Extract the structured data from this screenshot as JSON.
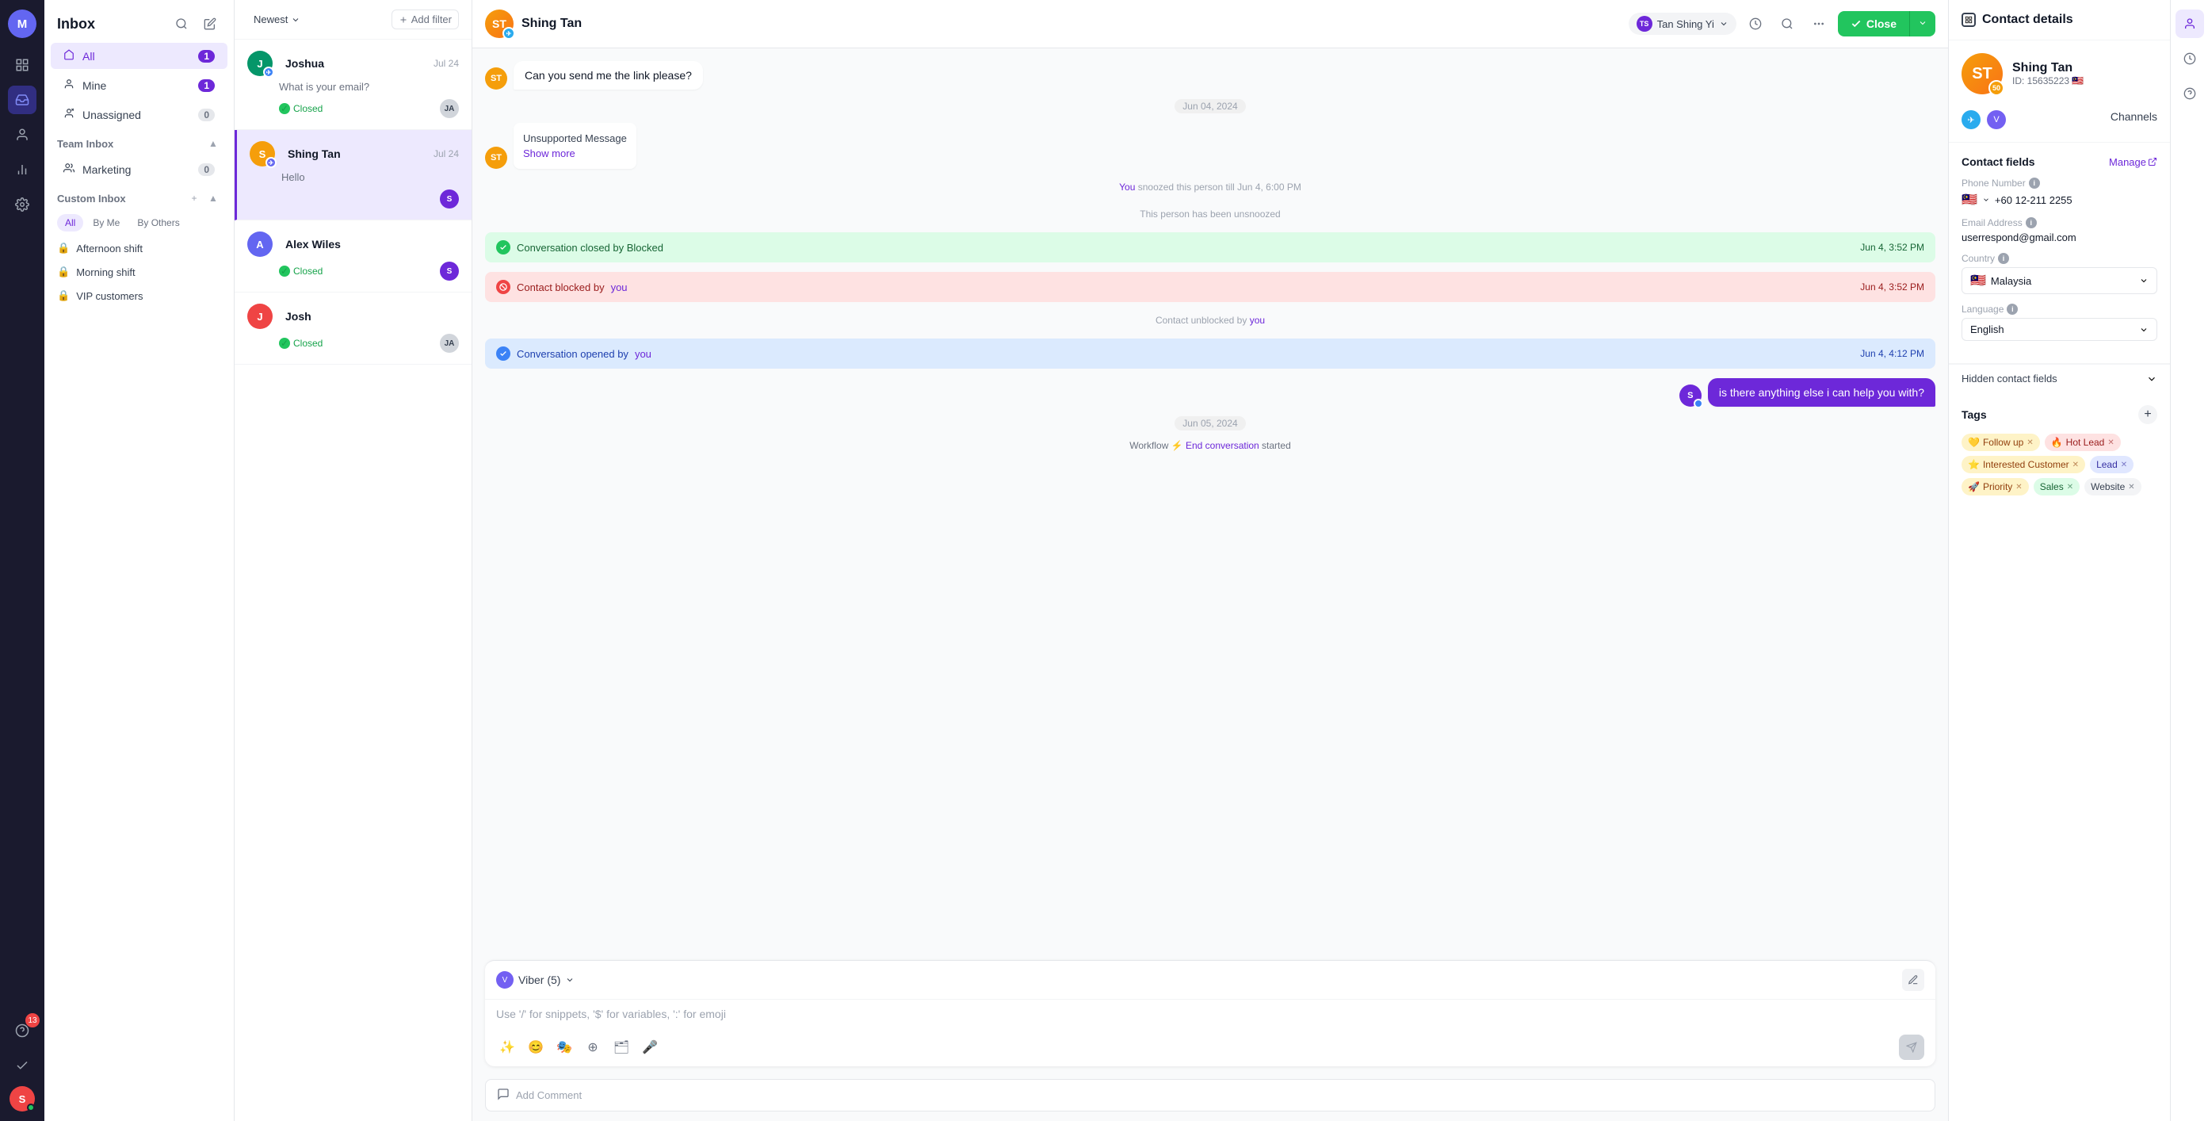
{
  "app": {
    "title": "Inbox"
  },
  "nav": {
    "user_initial": "S",
    "badge_count": "13",
    "icons": [
      "grid",
      "inbox",
      "contacts",
      "reports",
      "settings",
      "help",
      "checkmark"
    ]
  },
  "sidebar": {
    "title": "Inbox",
    "items": [
      {
        "id": "all",
        "label": "All",
        "count": "1",
        "active": true
      },
      {
        "id": "mine",
        "label": "Mine",
        "count": "1"
      },
      {
        "id": "unassigned",
        "label": "Unassigned",
        "count": "0"
      }
    ],
    "team_inbox": {
      "label": "Team Inbox",
      "items": [
        {
          "label": "Marketing",
          "count": "0"
        }
      ]
    },
    "custom_inbox": {
      "label": "Custom Inbox",
      "items": [
        {
          "label": "Afternoon shift"
        },
        {
          "label": "Morning shift"
        },
        {
          "label": "VIP customers"
        }
      ]
    },
    "filter_tabs": [
      "All",
      "By Me",
      "By Others"
    ]
  },
  "conversation_list": {
    "sort_label": "Newest",
    "add_filter_label": "Add filter",
    "conversations": [
      {
        "id": "joshua",
        "name": "Joshua",
        "preview": "What is your email?",
        "time": "Jul 24",
        "status": "Closed",
        "avatar_color": "#059669",
        "avatar_initial": "J"
      },
      {
        "id": "shing-tan",
        "name": "Shing Tan",
        "preview": "Hello",
        "time": "Jul 24",
        "status": "active",
        "avatar_color": "#f59e0b",
        "avatar_initial": "S",
        "active": true
      },
      {
        "id": "alex-wiles",
        "name": "Alex Wiles",
        "preview": "",
        "time": "",
        "status": "Closed",
        "avatar_color": "#6366f1",
        "avatar_initial": "A"
      },
      {
        "id": "josh",
        "name": "Josh",
        "preview": "",
        "time": "",
        "status": "Closed",
        "avatar_color": "#ef4444",
        "avatar_initial": "J"
      }
    ]
  },
  "chat": {
    "contact_name": "Shing Tan",
    "agent_name": "Tan Shing Yi",
    "close_label": "Close",
    "messages": [
      {
        "type": "received",
        "text": "Can you send me the link please?",
        "time": ""
      },
      {
        "type": "date",
        "text": "Jun 04, 2024"
      },
      {
        "type": "unsupported",
        "text": "Unsupported Message",
        "show_more": "Show more"
      },
      {
        "type": "system",
        "text": "You snoozed this person till Jun 4, 6:00 PM"
      },
      {
        "type": "system",
        "text": "This person has been unsnoozed"
      },
      {
        "type": "event_closed",
        "text": "Conversation closed by Blocked",
        "time": "Jun 4, 3:52 PM"
      },
      {
        "type": "event_blocked",
        "text": "Contact blocked by you",
        "time": "Jun 4, 3:52 PM"
      },
      {
        "type": "system",
        "text": "Contact unblocked by you"
      },
      {
        "type": "event_opened",
        "text": "Conversation opened by you",
        "time": "Jun 4, 4:12 PM"
      },
      {
        "type": "sent",
        "text": "is there anything else i can help you with?",
        "time": ""
      },
      {
        "type": "date",
        "text": "Jun 05, 2024"
      },
      {
        "type": "workflow",
        "text": "Workflow ⚡ End conversation started"
      }
    ],
    "input": {
      "channel": "Viber (5)",
      "placeholder": "Use '/' for snippets, '$' for variables, ':' for emoji"
    },
    "add_comment_label": "Add Comment"
  },
  "contact_details": {
    "title": "Contact details",
    "name": "Shing Tan",
    "id": "ID: 15635223",
    "flag": "🇲🇾",
    "channels_label": "Channels",
    "manage_label": "Manage",
    "fields_title": "Contact fields",
    "phone_label": "Phone Number",
    "phone_value": "+60 12-211 2255",
    "email_label": "Email Address",
    "email_value": "userrespond@gmail.com",
    "country_label": "Country",
    "country_value": "Malaysia",
    "language_label": "Language",
    "language_value": "English",
    "hidden_fields_label": "Hidden contact fields",
    "tags_title": "Tags",
    "tags": [
      {
        "id": "follow-up",
        "label": "Follow up",
        "emoji": "💛",
        "class": "follow-up"
      },
      {
        "id": "hot-lead",
        "label": "Hot Lead",
        "emoji": "🔥",
        "class": "hot-lead"
      },
      {
        "id": "interested",
        "label": "Interested Customer",
        "emoji": "⭐",
        "class": "interested"
      },
      {
        "id": "lead",
        "label": "Lead",
        "emoji": "",
        "class": "lead"
      },
      {
        "id": "priority",
        "label": "Priority",
        "emoji": "🚀",
        "class": "priority"
      },
      {
        "id": "sales",
        "label": "Sales",
        "emoji": "",
        "class": "sales"
      },
      {
        "id": "website",
        "label": "Website",
        "emoji": "",
        "class": "website"
      }
    ]
  }
}
